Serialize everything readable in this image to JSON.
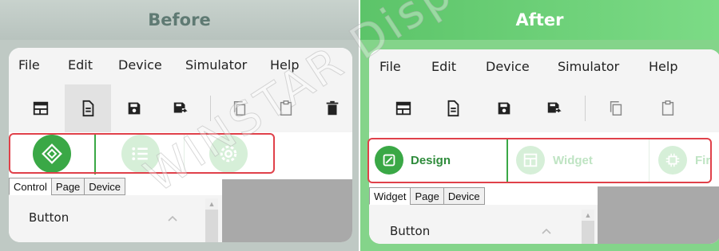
{
  "before": {
    "title": "Before",
    "menu": [
      "File",
      "Edit",
      "Device",
      "Simulator",
      "Help"
    ],
    "toolbar_icons": [
      "layout-icon",
      "document-icon",
      "save-icon",
      "save-as-icon",
      "copy-icon",
      "paste-icon",
      "delete-icon"
    ],
    "modes": [
      "design-mode-icon",
      "widget-list-icon",
      "settings-gear-icon"
    ],
    "tabs": [
      "Control",
      "Page",
      "Device"
    ],
    "active_tab": "Control",
    "section_label": "Button"
  },
  "after": {
    "title": "After",
    "menu": [
      "File",
      "Edit",
      "Device",
      "Simulator",
      "Help"
    ],
    "toolbar_icons": [
      "layout-icon",
      "document-icon",
      "save-icon",
      "save-as-icon",
      "copy-icon",
      "paste-icon"
    ],
    "modes": [
      {
        "label": "Design",
        "icon": "design-mode-icon"
      },
      {
        "label": "Widget",
        "icon": "widget-icon"
      },
      {
        "label": "Fir",
        "icon": "firmware-chip-icon"
      }
    ],
    "tabs": [
      "Widget",
      "Page",
      "Device"
    ],
    "active_tab": "Widget",
    "section_label": "Button"
  },
  "watermark": "WINSTAR Display",
  "colors": {
    "accent_green": "#3aa846",
    "callout_red": "#e0414a",
    "faded_green": "#d6efd8"
  }
}
